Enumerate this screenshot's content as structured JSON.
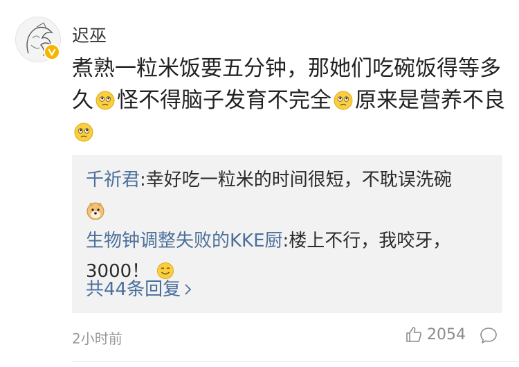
{
  "comment": {
    "username": "迟巫",
    "text_segments": [
      "煮熟一粒米饭要五分钟，那她们吃碗饭得等多久",
      "怪不得脑子发育不完全",
      "原来是营养不良"
    ],
    "emoji_name": "sad-face-emoji",
    "time": "2小时前",
    "like_count": "2054"
  },
  "replies": [
    {
      "name": "千祈君",
      "separator": ":",
      "text": "幸好吃一粒米的时间很短，不耽误洗碗",
      "emoji": "doge-emoji"
    },
    {
      "name": "生物钟调整失败的KKE厨",
      "separator": ":",
      "text": "楼上不行，我咬牙，3000！",
      "emoji": "smile-emoji"
    }
  ],
  "more_replies": "共44条回复",
  "colors": {
    "link": "#4a6f9a",
    "badge": "#f7b500",
    "reply_bg": "#f2f2f2"
  }
}
